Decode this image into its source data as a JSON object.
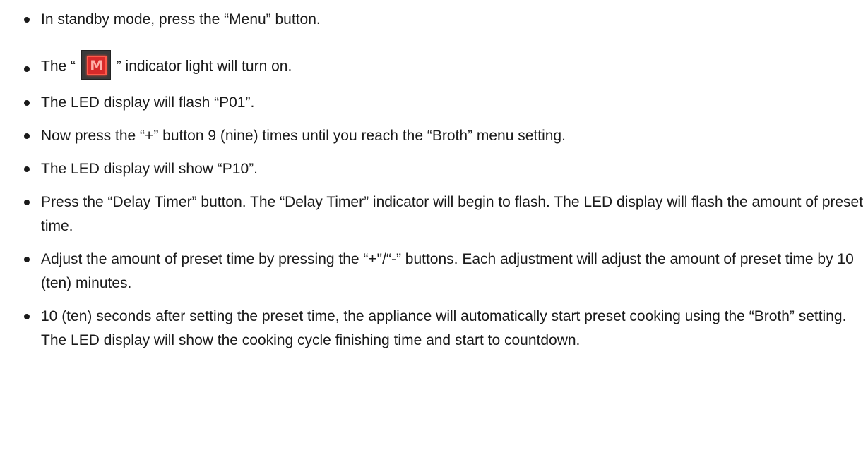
{
  "instructions": {
    "items": [
      "In standby mode, press the “Menu” button.",
      {
        "before": "The “",
        "icon": "menu-m-indicator-icon",
        "icon_letter": "M",
        "after": "” indicator light will turn on."
      },
      "The LED display will flash “P01”.",
      "Now press the “+” button 9 (nine) times until you reach the “Broth” menu setting.",
      "The LED display will show “P10”.",
      "Press the “Delay Timer” button.  The “Delay Timer” indicator will begin to flash.  The LED display will flash the amount of preset time.",
      "Adjust the amount of preset time by pressing the “+\"/“-” buttons.  Each adjustment will adjust the amount of preset time by 10 (ten) minutes.",
      "10 (ten) seconds after setting the preset time, the appliance will automatically start preset cooking using the “Broth” setting.  The LED display will show the cooking cycle finishing time and start to countdown."
    ]
  },
  "colors": {
    "text": "#1a1a1a",
    "icon_frame": "#3a3a3a",
    "icon_red": "#d72a2a",
    "icon_glow": "#ff5a4a"
  }
}
